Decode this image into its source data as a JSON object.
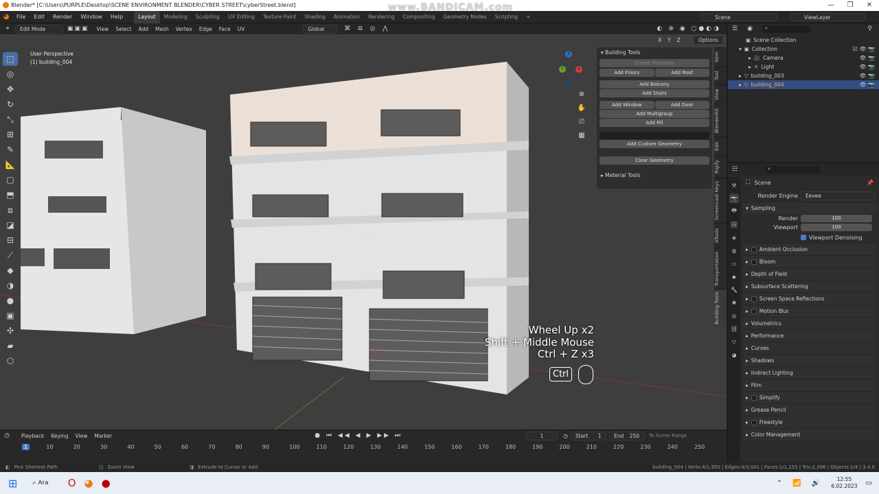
{
  "titlebar": {
    "title": "Blender* [C:\\Users\\PURPLE\\Desktop\\SCENE ENVIRONMENT BLENDER\\CYBER STREET\\cyberStreet.blend]",
    "watermark": "www.BANDICAM.com",
    "minimize": "—",
    "maximize": "❐",
    "close": "✕"
  },
  "menu": {
    "items": [
      "File",
      "Edit",
      "Render",
      "Window",
      "Help"
    ],
    "workspaces": [
      "Layout",
      "Modeling",
      "Sculpting",
      "UV Editing",
      "Texture Paint",
      "Shading",
      "Animation",
      "Rendering",
      "Compositing",
      "Geometry Nodes",
      "Scripting"
    ],
    "active_workspace": "Layout",
    "add_workspace": "+",
    "scene_label": "Scene",
    "viewlayer_label": "ViewLayer"
  },
  "viewport_header": {
    "mode": "Edit Mode",
    "menus": [
      "View",
      "Select",
      "Add",
      "Mesh",
      "Vertex",
      "Edge",
      "Face",
      "UV"
    ],
    "orientation": "Global",
    "axes": [
      "X",
      "Y",
      "Z"
    ],
    "options": "Options"
  },
  "viewport": {
    "view_name": "User Perspective",
    "object_name": "(1) building_004",
    "keystrokes": [
      "Wheel Up x2",
      "Shift + Middle Mouse",
      "Ctrl + Z x3"
    ],
    "ctrl_badge": "Ctrl",
    "gizmo": {
      "x": "X",
      "y": "Y",
      "z": "Z"
    }
  },
  "npanel": {
    "title": "Building Tools",
    "create_floorplan": "Create Floorplan",
    "add_floors": "Add Floors",
    "add_roof": "Add Roof",
    "add_balcony": "Add Balcony",
    "add_stairs": "Add Stairs",
    "add_window": "Add Window",
    "add_door": "Add Door",
    "add_multigroup": "Add Multigroup",
    "add_fill": "Add Fill",
    "add_custom_geometry": "Add Custom Geometry",
    "clear_geometry": "Clear Geometry",
    "material_tools": "Material Tools"
  },
  "sidebar_tabs": [
    "Item",
    "Tool",
    "View",
    "BlenderKit",
    "Edit",
    "Rigify",
    "Screencast Keys",
    "ATools",
    "Transportation",
    "Building Tools"
  ],
  "outliner": {
    "scene_collection": "Scene Collection",
    "collection": "Collection",
    "camera": "Camera",
    "light": "Light",
    "building_003": "building_003",
    "building_004": "building_004"
  },
  "properties": {
    "scene": "Scene",
    "render_engine_label": "Render Engine",
    "render_engine": "Eevee",
    "sampling": "Sampling",
    "render_label": "Render",
    "render_value": "100",
    "viewport_label": "Viewport",
    "viewport_value": "100",
    "viewport_denoising": "Viewport Denoising",
    "sections": [
      {
        "label": "Ambient Occlusion",
        "checkbox": true
      },
      {
        "label": "Bloom",
        "checkbox": true
      },
      {
        "label": "Depth of Field",
        "checkbox": false
      },
      {
        "label": "Subsurface Scattering",
        "checkbox": false
      },
      {
        "label": "Screen Space Reflections",
        "checkbox": true
      },
      {
        "label": "Motion Blur",
        "checkbox": true
      },
      {
        "label": "Volumetrics",
        "checkbox": false
      },
      {
        "label": "Performance",
        "checkbox": false
      },
      {
        "label": "Curves",
        "checkbox": false
      },
      {
        "label": "Shadows",
        "checkbox": false
      },
      {
        "label": "Indirect Lighting",
        "checkbox": false
      },
      {
        "label": "Film",
        "checkbox": false
      },
      {
        "label": "Simplify",
        "checkbox": true
      },
      {
        "label": "Grease Pencil",
        "checkbox": false
      },
      {
        "label": "Freestyle",
        "checkbox": true
      },
      {
        "label": "Color Management",
        "checkbox": false
      }
    ]
  },
  "timeline": {
    "menus": [
      "Playback",
      "Keying",
      "View",
      "Marker"
    ],
    "current_frame": "1",
    "start_label": "Start",
    "start": "1",
    "end_label": "End",
    "end": "250",
    "scene_range": "To Scene Range",
    "ticks": [
      "1",
      "10",
      "20",
      "30",
      "40",
      "50",
      "60",
      "70",
      "80",
      "90",
      "100",
      "110",
      "120",
      "130",
      "140",
      "150",
      "160",
      "170",
      "180",
      "190",
      "200",
      "210",
      "220",
      "230",
      "240",
      "250"
    ]
  },
  "statusbar": {
    "left1": "Pick Shortest Path",
    "left2": "Zoom View",
    "left3": "Extrude to Cursor or Add",
    "stats": "building_004 | Verts:4/1,950 | Edges:4/3,041 | Faces:1/1,155 | Tris:2,396 | Objects:1/4 | 3.4.0"
  },
  "taskbar": {
    "search": "Ara",
    "time": "12:55",
    "date": "6.02.2023"
  }
}
